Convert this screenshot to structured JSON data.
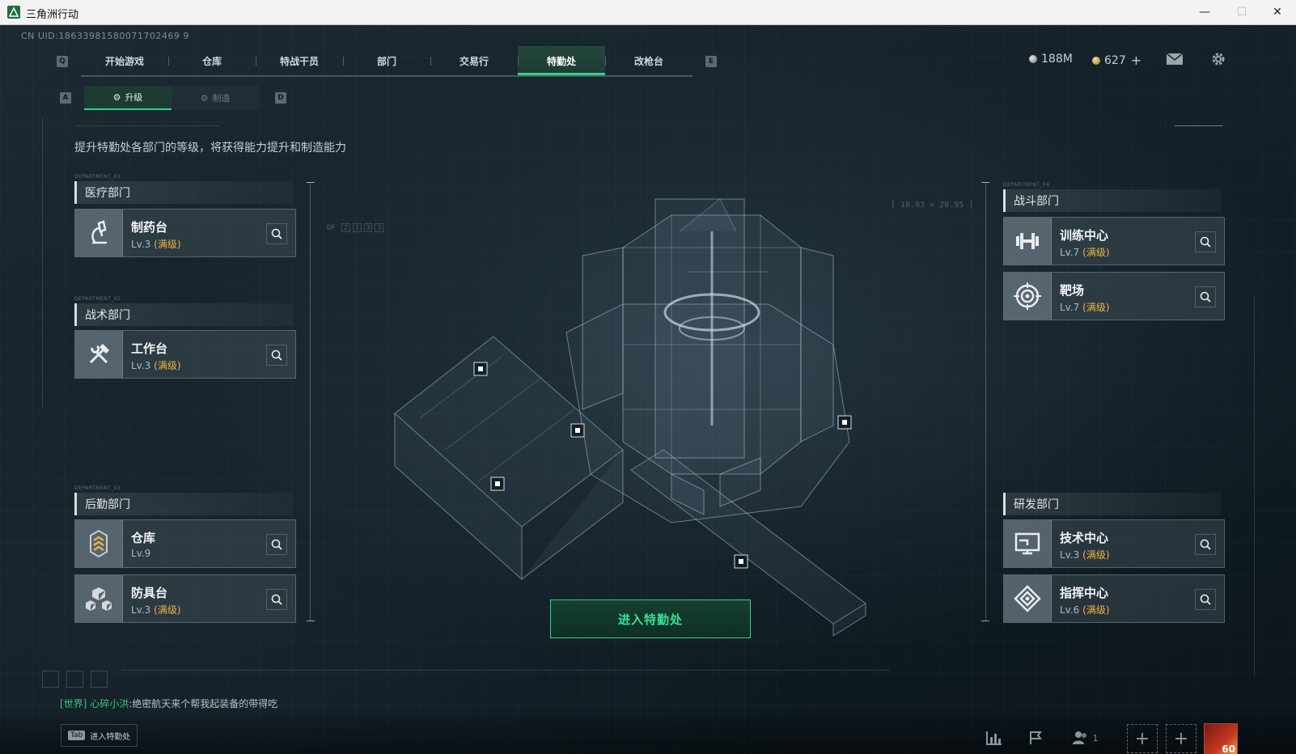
{
  "window": {
    "title": "三角洲行动"
  },
  "uid": "CN UID:18633981580071702469 9",
  "nav": {
    "key_left": "Q",
    "key_right": "E",
    "tabs": [
      {
        "label": "开始游戏"
      },
      {
        "label": "仓库"
      },
      {
        "label": "特战干员"
      },
      {
        "label": "部门"
      },
      {
        "label": "交易行"
      },
      {
        "label": "特勤处",
        "active": true
      },
      {
        "label": "改枪台"
      }
    ]
  },
  "currency": {
    "money": "188M",
    "coins": "627",
    "coin_add": "+"
  },
  "subtabs": {
    "key_left": "A",
    "key_right": "D",
    "upgrade": "升级",
    "craft": "制造"
  },
  "subtitle": "提升特勤处各部门的等级，将获得能力提升和制造能力",
  "departments": {
    "medical": {
      "tag": "DEPARTMENT_01",
      "label": "医疗部门",
      "items": [
        {
          "name": "制药台",
          "level": "Lv.3",
          "max": "(满级)",
          "icon": "microscope-icon"
        }
      ]
    },
    "tactical": {
      "tag": "DEPARTMENT_02",
      "label": "战术部门",
      "items": [
        {
          "name": "工作台",
          "level": "Lv.3",
          "max": "(满级)",
          "icon": "hammer-wrench-icon"
        }
      ]
    },
    "logistics": {
      "tag": "DEPARTMENT_03",
      "label": "后勤部门",
      "items": [
        {
          "name": "仓库",
          "level": "Lv.9",
          "max": "",
          "icon": "rank-chevrons-icon"
        },
        {
          "name": "防具台",
          "level": "Lv.3",
          "max": "(满级)",
          "icon": "cubes-icon"
        }
      ]
    },
    "combat": {
      "tag": "DEPARTMENT_04",
      "label": "战斗部门",
      "items": [
        {
          "name": "训练中心",
          "level": "Lv.7",
          "max": "(满级)",
          "icon": "dumbbell-icon"
        },
        {
          "name": "靶场",
          "level": "Lv.7",
          "max": "(满级)",
          "icon": "target-icon"
        }
      ]
    },
    "research": {
      "label": "研发部门",
      "items": [
        {
          "name": "技术中心",
          "level": "Lv.3",
          "max": "(满级)",
          "icon": "monitor-icon"
        },
        {
          "name": "指挥中心",
          "level": "Lv.6",
          "max": "(满级)",
          "icon": "command-diamond-icon"
        }
      ]
    }
  },
  "enter_button": "进入特勤处",
  "chat": {
    "channel": "[世界]",
    "user": "心碎小洪",
    "message": ":绝密航天来个帮我起装备的带得吃"
  },
  "bottom": {
    "tab_key": "Tab",
    "tab_label": "进入特勤处",
    "friends_count": "1",
    "avatar_level": "60"
  },
  "deco": {
    "coords": "[ 18.03 × 20.95 ]",
    "df": "DF",
    "df_digits": [
      "2",
      "3",
      "3",
      "3"
    ]
  },
  "colors": {
    "accent": "#2fd38a",
    "max_level": "#e6b545",
    "active_tab": "#1e3b33"
  }
}
